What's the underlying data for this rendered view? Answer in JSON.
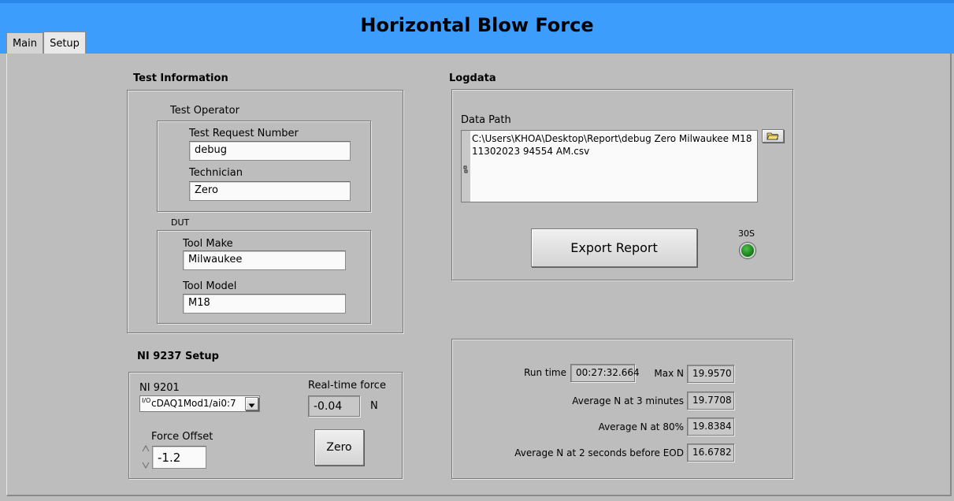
{
  "header": {
    "title": "Horizontal Blow Force"
  },
  "tabs": [
    {
      "label": "Main"
    },
    {
      "label": "Setup"
    }
  ],
  "test_info": {
    "section_title": "Test Information",
    "operator_group": "Test Operator",
    "request_number_label": "Test Request Number",
    "request_number_value": "debug",
    "technician_label": "Technician",
    "technician_value": "Zero",
    "dut_group": "DUT",
    "tool_make_label": "Tool Make",
    "tool_make_value": "Milwaukee",
    "tool_model_label": "Tool Model",
    "tool_model_value": "M18"
  },
  "logdata": {
    "section_title": "Logdata",
    "data_path_label": "Data Path",
    "data_path_line1": "C:\\Users\\KHOA\\Desktop\\Report\\debug Zero Milwaukee M18",
    "data_path_line2": "11302023 94554 AM.csv",
    "export_button": "Export Report",
    "led_label": "30S",
    "led_color": "#1f8f1f"
  },
  "ni_setup": {
    "section_title": "NI 9237 Setup",
    "channel_label": "NI 9201",
    "channel_prefix": "I/O",
    "channel_value": "cDAQ1Mod1/ai0:7",
    "force_label": "Real-time force",
    "force_value": "-0.04",
    "force_unit": "N",
    "offset_label": "Force Offset",
    "offset_value": "-1.2",
    "zero_button": "Zero"
  },
  "results": {
    "run_time_label": "Run time",
    "run_time_value": "00:27:32.664",
    "max_label": "Max N",
    "max_value": "19.9570",
    "avg3_label": "Average N at 3 minutes",
    "avg3_value": "19.7708",
    "avg80_label": "Average N at 80%",
    "avg80_value": "19.8384",
    "avg_eod_label": "Average N at 2 seconds before EOD",
    "avg_eod_value": "16.6782"
  },
  "colors": {
    "header": "#3d9dfd",
    "background": "#bdbdbd"
  },
  "icons": {
    "browse": "folder-icon",
    "spinner": "spinner-arrows-icon",
    "dropdown": "chevron-down-icon"
  }
}
